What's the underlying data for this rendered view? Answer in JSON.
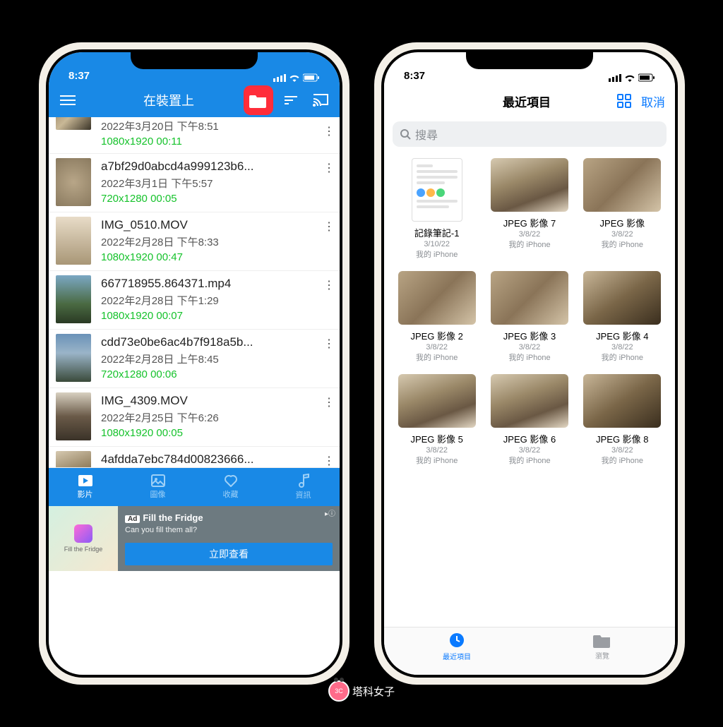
{
  "status": {
    "time": "8:37"
  },
  "left": {
    "header_title": "在裝置上",
    "videos": [
      {
        "name": "—",
        "date": "2022年3月20日 下午8:51",
        "res": "1080x1920 00:11",
        "thumb": "t1"
      },
      {
        "name": "a7bf29d0abcd4a999123b6...",
        "date": "2022年3月1日 下午5:57",
        "res": "720x1280 00:05",
        "thumb": "t2"
      },
      {
        "name": "IMG_0510.MOV",
        "date": "2022年2月28日 下午8:33",
        "res": "1080x1920 00:47",
        "thumb": "t3"
      },
      {
        "name": "667718955.864371.mp4",
        "date": "2022年2月28日 下午1:29",
        "res": "1080x1920 00:07",
        "thumb": "t4"
      },
      {
        "name": "cdd73e0be6ac4b7f918a5b...",
        "date": "2022年2月28日 上午8:45",
        "res": "720x1280 00:06",
        "thumb": "t5"
      },
      {
        "name": "IMG_4309.MOV",
        "date": "2022年2月25日 下午6:26",
        "res": "1080x1920 00:05",
        "thumb": "t6"
      },
      {
        "name": "4afdda7ebc784d00823666...",
        "date": "",
        "res": "",
        "thumb": "cat1"
      }
    ],
    "tabs": [
      {
        "label": "影片",
        "active": true
      },
      {
        "label": "圖像",
        "active": false
      },
      {
        "label": "收藏",
        "active": false
      },
      {
        "label": "資訊",
        "active": false
      }
    ],
    "ad": {
      "badge": "Ad",
      "title": "Fill the Fridge",
      "sub": "Can you fill them all?",
      "cta": "立即查看",
      "img_caption": "Fill the Fridge"
    }
  },
  "right": {
    "title": "最近項目",
    "grid_label": "切換檢視",
    "cancel": "取消",
    "search_placeholder": "搜尋",
    "items": [
      {
        "name": "記錄筆記-1",
        "date": "3/10/22",
        "loc": "我的 iPhone",
        "type": "doc"
      },
      {
        "name": "JPEG 影像 7",
        "date": "3/8/22",
        "loc": "我的 iPhone",
        "type": "img",
        "thumb": "cat1"
      },
      {
        "name": "JPEG 影像",
        "date": "3/8/22",
        "loc": "我的 iPhone",
        "type": "img",
        "thumb": "cat2"
      },
      {
        "name": "JPEG 影像 2",
        "date": "3/8/22",
        "loc": "我的 iPhone",
        "type": "img",
        "thumb": "cat2"
      },
      {
        "name": "JPEG 影像 3",
        "date": "3/8/22",
        "loc": "我的 iPhone",
        "type": "img",
        "thumb": "cat2"
      },
      {
        "name": "JPEG 影像 4",
        "date": "3/8/22",
        "loc": "我的 iPhone",
        "type": "img",
        "thumb": "cat3"
      },
      {
        "name": "JPEG 影像 5",
        "date": "3/8/22",
        "loc": "我的 iPhone",
        "type": "img",
        "thumb": "cat1"
      },
      {
        "name": "JPEG 影像 6",
        "date": "3/8/22",
        "loc": "我的 iPhone",
        "type": "img",
        "thumb": "cat1"
      },
      {
        "name": "JPEG 影像 8",
        "date": "3/8/22",
        "loc": "我的 iPhone",
        "type": "img",
        "thumb": "cat3"
      }
    ],
    "tabs": [
      {
        "label": "最近項目",
        "active": true
      },
      {
        "label": "瀏覽",
        "active": false
      }
    ]
  },
  "watermark": "塔科女子"
}
